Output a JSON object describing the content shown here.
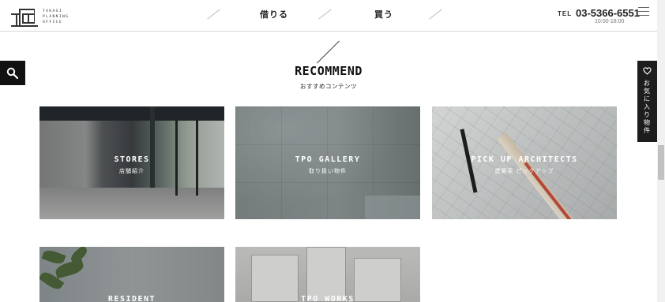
{
  "header": {
    "logo_text_lines": [
      "TAKAGI",
      "PLANNING",
      "OFFICE"
    ],
    "nav": [
      {
        "label": "借りる"
      },
      {
        "label": "買う"
      }
    ],
    "tel_label": "TEL",
    "tel_number": "03-5366-6551",
    "tel_hours": "10:00-18:00"
  },
  "favorites": {
    "label": "お気に入り物件"
  },
  "section": {
    "title": "RECOMMEND",
    "subtitle": "おすすめコンテンツ"
  },
  "cards": [
    {
      "title": "STORES",
      "subtitle": "店舗紹介"
    },
    {
      "title": "TPO GALLERY",
      "subtitle": "取り扱い物件"
    },
    {
      "title": "PICK UP ARCHITECTS",
      "subtitle": "建築家 ピックアップ"
    },
    {
      "title": "RESIDENT",
      "subtitle": ""
    },
    {
      "title": "TPO WORKS",
      "subtitle": ""
    }
  ]
}
